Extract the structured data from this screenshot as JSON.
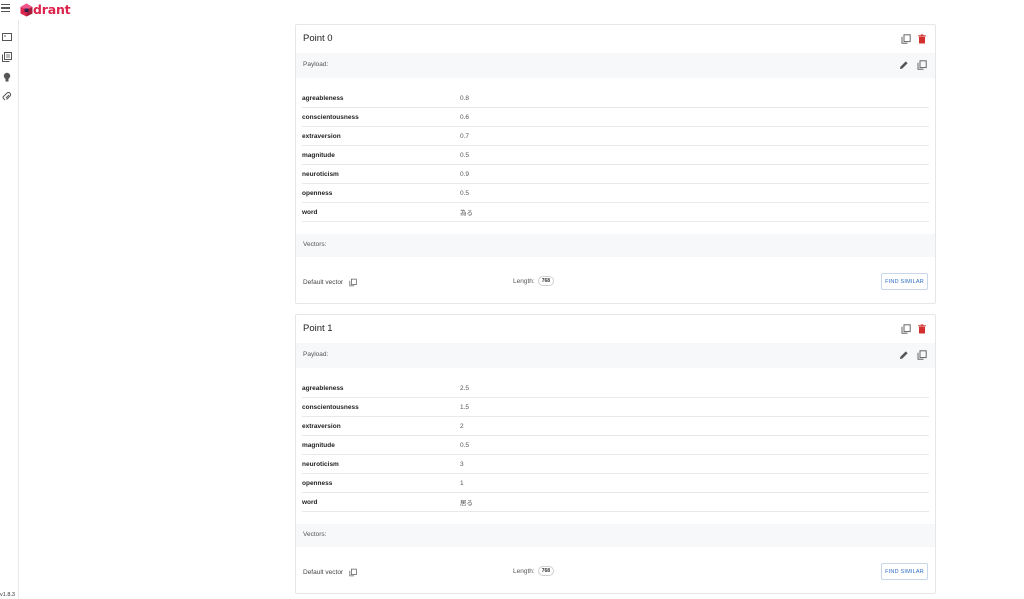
{
  "app": {
    "logo_text": "drant",
    "version": "v1.8.3"
  },
  "colors": {
    "brand": "#dc244c",
    "delete": "#d32f2f",
    "link": "#2c6cc4"
  },
  "sidebar": {
    "items": [
      {
        "icon": "console-icon"
      },
      {
        "icon": "collections-icon"
      },
      {
        "icon": "tutorial-icon"
      },
      {
        "icon": "datasets-icon"
      }
    ]
  },
  "points": [
    {
      "title": "Point 0",
      "payload_label": "Payload:",
      "payload": [
        {
          "key": "agreableness",
          "value": "0.8"
        },
        {
          "key": "conscientousness",
          "value": "0.6"
        },
        {
          "key": "extraversion",
          "value": "0.7"
        },
        {
          "key": "magnitude",
          "value": "0.5"
        },
        {
          "key": "neuroticism",
          "value": "0.9"
        },
        {
          "key": "openness",
          "value": "0.5"
        },
        {
          "key": "word",
          "value": "為る"
        }
      ],
      "vectors_label": "Vectors:",
      "vector": {
        "name": "Default vector",
        "length_label": "Length:",
        "length": "768",
        "find_label": "FIND SIMILAR"
      }
    },
    {
      "title": "Point 1",
      "payload_label": "Payload:",
      "payload": [
        {
          "key": "agreableness",
          "value": "2.5"
        },
        {
          "key": "conscientousness",
          "value": "1.5"
        },
        {
          "key": "extraversion",
          "value": "2"
        },
        {
          "key": "magnitude",
          "value": "0.5"
        },
        {
          "key": "neuroticism",
          "value": "3"
        },
        {
          "key": "openness",
          "value": "1"
        },
        {
          "key": "word",
          "value": "居る"
        }
      ],
      "vectors_label": "Vectors:",
      "vector": {
        "name": "Default vector",
        "length_label": "Length:",
        "length": "768",
        "find_label": "FIND SIMILAR"
      }
    }
  ]
}
